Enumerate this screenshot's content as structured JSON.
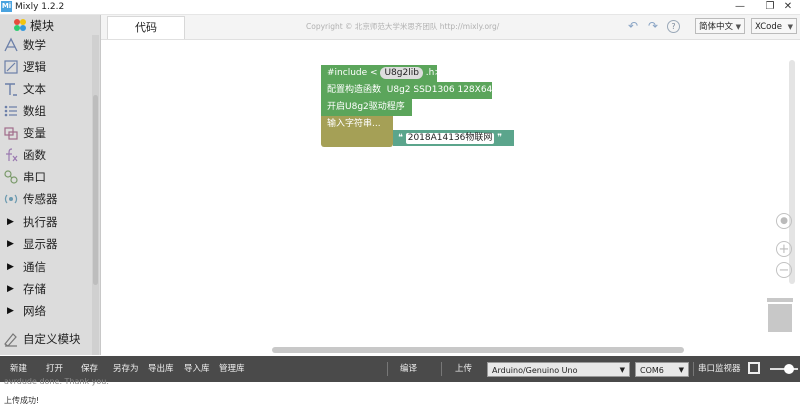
{
  "window": {
    "title": "Mixly 1.2.2",
    "logo_text": "Mi",
    "minimize_glyph": "—",
    "maximize_glyph": "❐",
    "close_glyph": "✕"
  },
  "sidebar": {
    "header": "模块",
    "categories": [
      {
        "label": "数学",
        "icon": "math-icon"
      },
      {
        "label": "逻辑",
        "icon": "logic-icon"
      },
      {
        "label": "文本",
        "icon": "text-icon"
      },
      {
        "label": "数组",
        "icon": "list-icon"
      },
      {
        "label": "变量",
        "icon": "variable-icon"
      },
      {
        "label": "函数",
        "icon": "function-icon"
      },
      {
        "label": "串口",
        "icon": "serial-icon"
      },
      {
        "label": "传感器",
        "icon": "sensor-icon"
      },
      {
        "label": "执行器",
        "icon": "expand-triangle-icon"
      },
      {
        "label": "显示器",
        "icon": "expand-triangle-icon"
      },
      {
        "label": "通信",
        "icon": "expand-triangle-icon"
      },
      {
        "label": "存储",
        "icon": "expand-triangle-icon"
      },
      {
        "label": "网络",
        "icon": "expand-triangle-icon"
      },
      {
        "label": "自定义模块",
        "icon": "custom-module-icon"
      }
    ]
  },
  "tabs": {
    "code_tab": "代码",
    "copyright": "Copyright © 北京师范大学米思齐团队 http://mixly.org/",
    "language": "简体中文",
    "theme": "XCode"
  },
  "blocks": {
    "include_prefix": "#include <",
    "include_lib": "U8g2lib",
    "include_suffix": ".h>",
    "config_label": "配置构造函数",
    "config_value": "U8g2 SSD1306 128X64",
    "init_label": "开启U8g2驱动程序",
    "input_label": "输入字符串...",
    "string_value": "2018A14136物联网",
    "open_quote": "❝",
    "close_quote": "❞"
  },
  "toolbar": {
    "new": "新建",
    "open": "打开",
    "save": "保存",
    "save_as": "另存为",
    "export_lib": "导出库",
    "import_lib": "导入库",
    "manage_lib": "管理库",
    "compile": "编译",
    "upload": "上传",
    "board": "Arduino/Genuino Uno",
    "port": "COM6",
    "serial_monitor": "串口监视器"
  },
  "console": {
    "line1": "avrdude done.  Thank you.",
    "line2": "上传成功!"
  },
  "colors": {
    "sidebar_bg": "#dcdcdc",
    "toolbar_bg": "#4a4a4a",
    "block_green": "#5ba55b",
    "block_olive": "#a5a056",
    "block_text": "#5ba58c"
  }
}
